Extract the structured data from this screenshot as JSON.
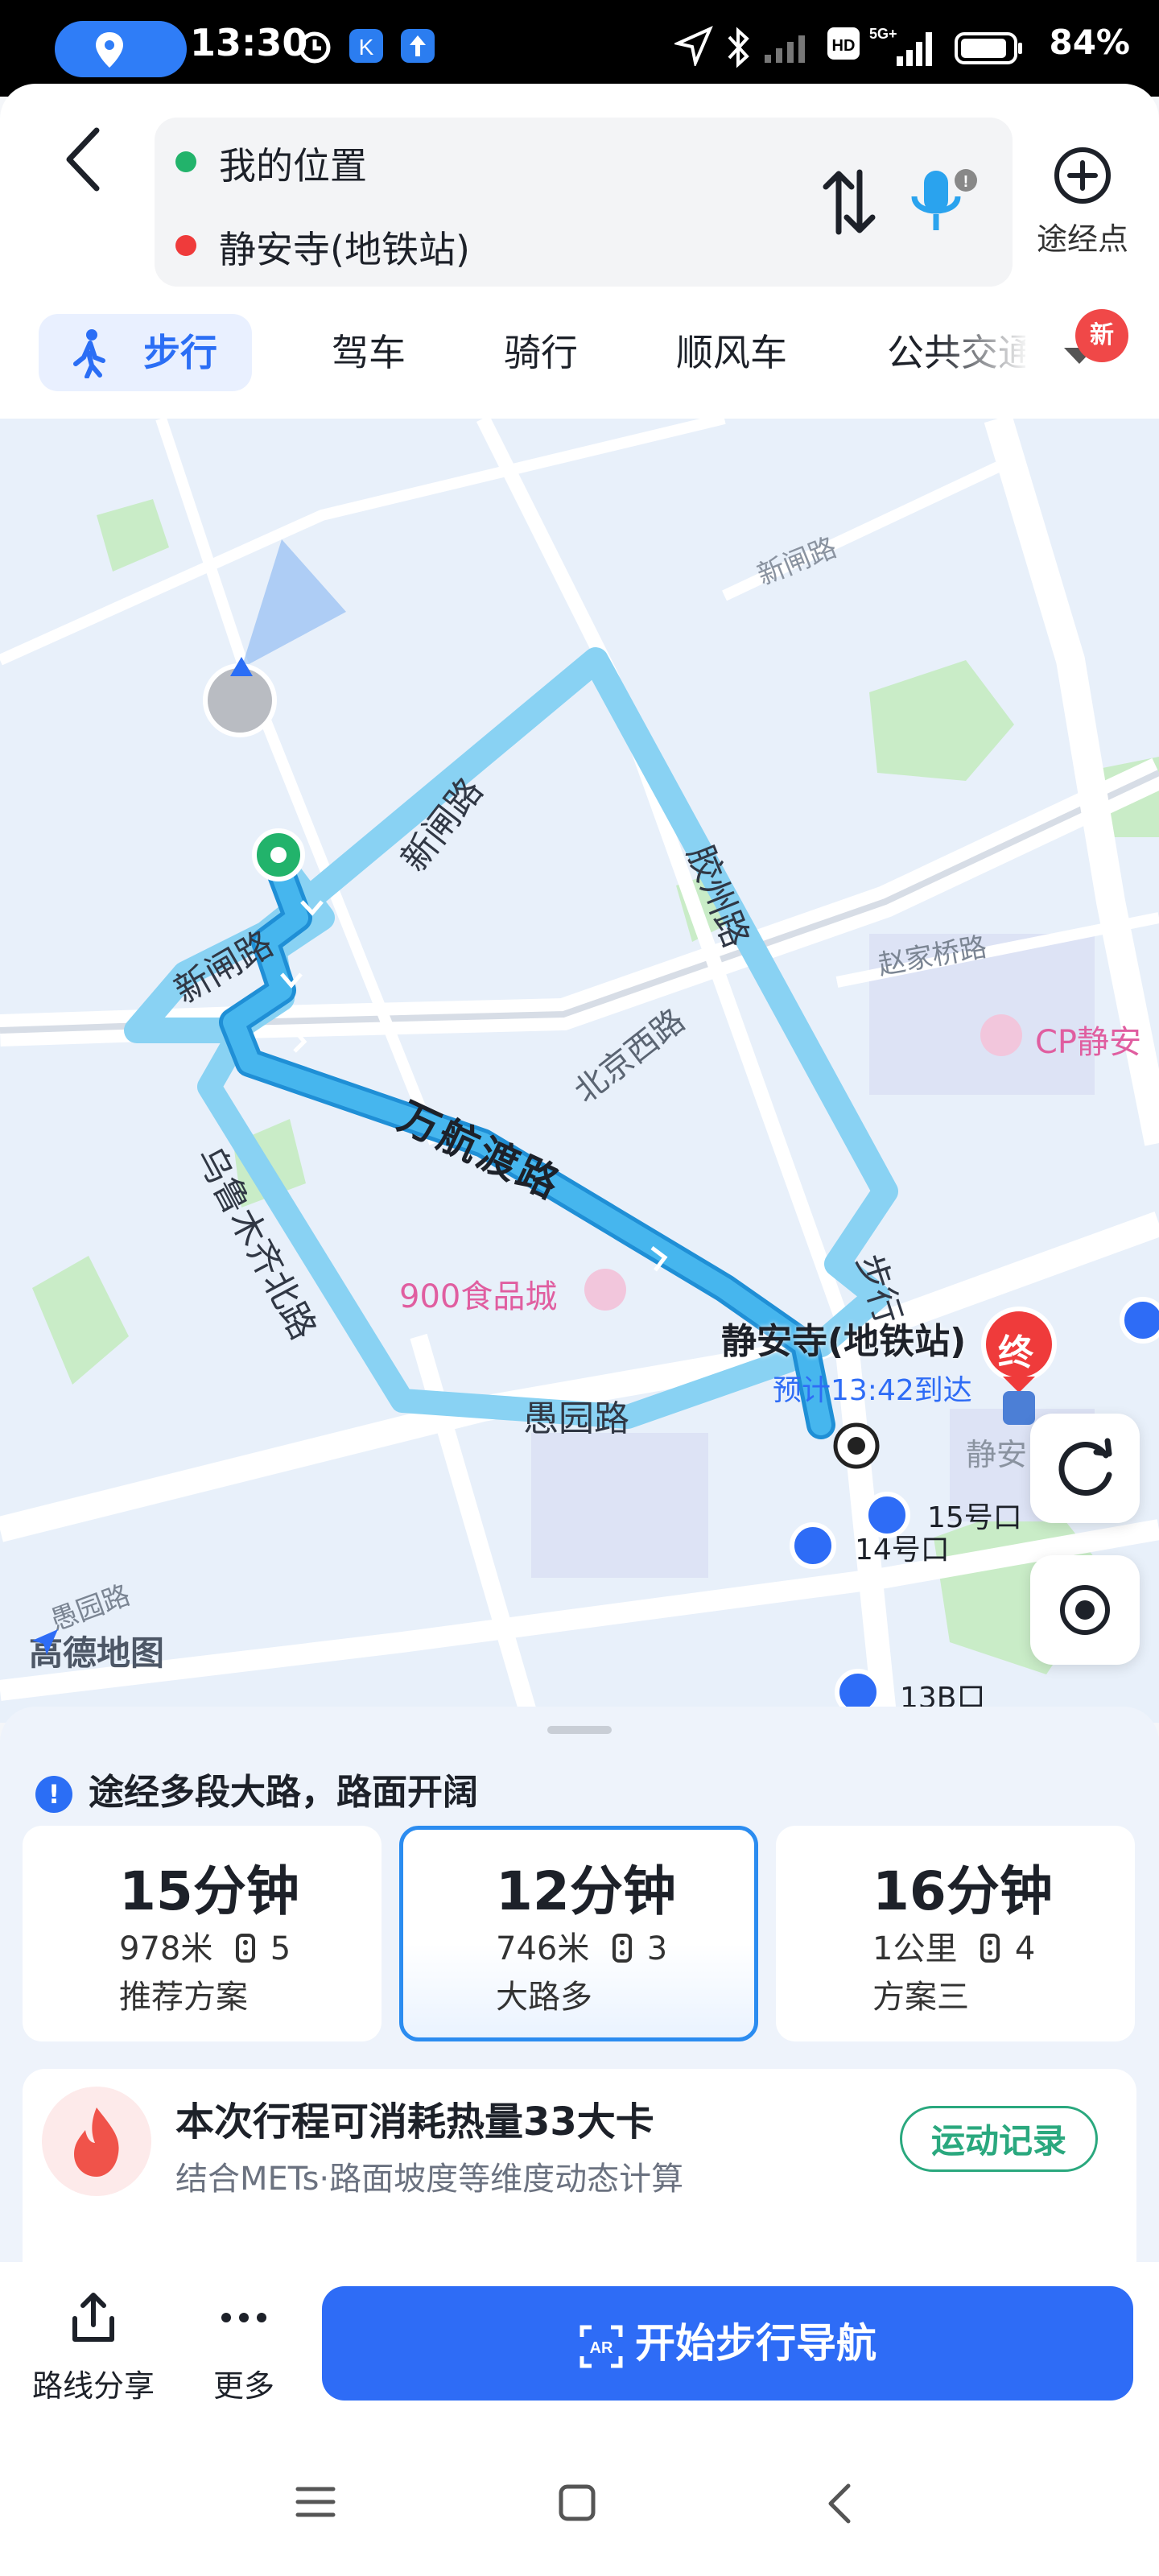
{
  "status_bar": {
    "time": "13:30",
    "battery": "84%",
    "network": "5G+",
    "hd": "HD"
  },
  "route": {
    "back_icon": "back-arrow-icon",
    "origin": "我的位置",
    "destination": "静安寺(地铁站)",
    "origin_color": "#22b36b",
    "destination_color": "#ef3b3b",
    "waypoint_label": "途经点"
  },
  "tabs": {
    "items": [
      "步行",
      "驾车",
      "骑行",
      "顺风车",
      "公共交通"
    ],
    "active": "步行",
    "new_badge": "新"
  },
  "map": {
    "streets": [
      "新闸路",
      "新闸路",
      "新闸路",
      "万航渡路",
      "胶州路",
      "北京西路",
      "赵家桥路",
      "乌鲁木齐北路",
      "愚园路",
      "愚园路",
      "步行"
    ],
    "poi_shop": "CP静安",
    "poi_food": "900食品城",
    "destination_label": "静安寺(地铁站)",
    "eta": "预计13:42到达",
    "end_marker": "终",
    "station_label": "静安",
    "exits": [
      "15号口",
      "14号口",
      "13B口"
    ],
    "brand": "高德地图",
    "route_color": "#46b6ee"
  },
  "sheet": {
    "hint": "途经多段大路，路面开阔",
    "options": [
      {
        "time": "15分钟",
        "distance": "978米",
        "lights": "5",
        "note": "推荐方案"
      },
      {
        "time": "12分钟",
        "distance": "746米",
        "lights": "3",
        "note": "大路多"
      },
      {
        "time": "16分钟",
        "distance": "1公里",
        "lights": "4",
        "note": "方案三"
      }
    ],
    "selected_index": 1
  },
  "calorie": {
    "title": "本次行程可消耗热量33大卡",
    "subtitle": "结合METs·路面坡度等维度动态计算",
    "button": "运动记录"
  },
  "actions": {
    "share": "路线分享",
    "more": "更多",
    "start": "开始步行导航"
  },
  "colors": {
    "primary": "#2e6cf6",
    "accent_green": "#2aa87e"
  }
}
